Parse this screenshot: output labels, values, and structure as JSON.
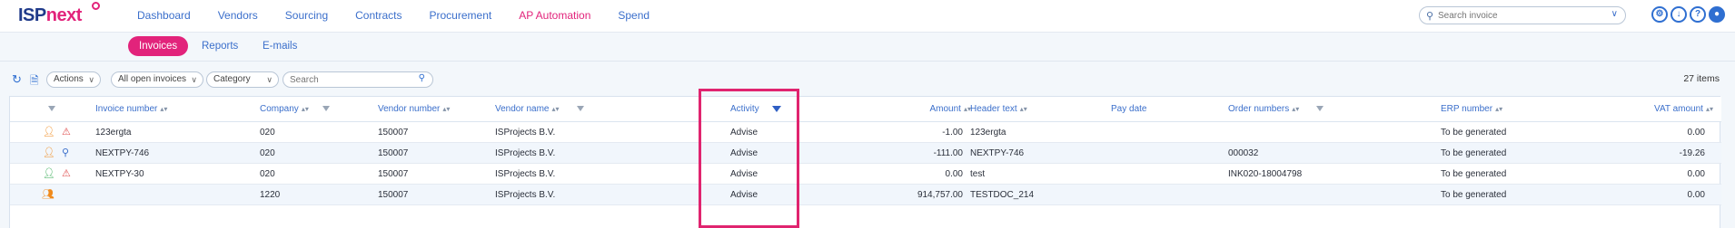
{
  "brand": {
    "part1": "ISP",
    "part2": "next"
  },
  "nav": [
    {
      "label": "Dashboard",
      "active": false
    },
    {
      "label": "Vendors",
      "active": false
    },
    {
      "label": "Sourcing",
      "active": false
    },
    {
      "label": "Contracts",
      "active": false
    },
    {
      "label": "Procurement",
      "active": false
    },
    {
      "label": "AP Automation",
      "active": true
    },
    {
      "label": "Spend",
      "active": false
    }
  ],
  "top_search": {
    "placeholder": "Search invoice"
  },
  "tool_icons": [
    "settings-icon",
    "download-icon",
    "help-icon",
    "user-icon"
  ],
  "subnav": {
    "invoices": "Invoices",
    "reports": "Reports",
    "emails": "E-mails"
  },
  "toolbar": {
    "actions": "Actions",
    "view": "All open invoices",
    "category": "Category",
    "search_placeholder": "Search",
    "count": "27 items"
  },
  "columns": {
    "invoice_number": "Invoice number",
    "company": "Company",
    "vendor_number": "Vendor number",
    "vendor_name": "Vendor name",
    "activity": "Activity",
    "amount": "Amount",
    "header_text": "Header text",
    "pay_date": "Pay date",
    "order_numbers": "Order numbers",
    "erp_number": "ERP number",
    "vat_amount": "VAT amount"
  },
  "rows": [
    {
      "status_icon": "user-outline-icon",
      "alert_icon": "warning-icon",
      "invoice_number": "123ergta",
      "company": "020",
      "vendor_number": "150007",
      "vendor_name": "ISProjects B.V.",
      "activity": "Advise",
      "amount": "-1.00",
      "header_text": "123ergta",
      "pay_date": "",
      "order_numbers": "",
      "erp_number": "To be generated",
      "vat_amount": "0.00"
    },
    {
      "status_icon": "user-outline-icon",
      "alert_icon": "search-doc-icon",
      "invoice_number": "NEXTPY-746",
      "company": "020",
      "vendor_number": "150007",
      "vendor_name": "ISProjects B.V.",
      "activity": "Advise",
      "amount": "-111.00",
      "header_text": "NEXTPY-746",
      "pay_date": "",
      "order_numbers": "000032",
      "erp_number": "To be generated",
      "vat_amount": "-19.26"
    },
    {
      "status_icon": "user-filled-icon",
      "alert_icon": "warning-icon",
      "invoice_number": "NEXTPY-30",
      "company": "020",
      "vendor_number": "150007",
      "vendor_name": "ISProjects B.V.",
      "activity": "Advise",
      "amount": "0.00",
      "header_text": "test",
      "pay_date": "",
      "order_numbers": "INK020-18004798",
      "erp_number": "To be generated",
      "vat_amount": "0.00"
    },
    {
      "status_icon": "users-outline-icon",
      "alert_icon": "",
      "invoice_number": "",
      "company": "1220",
      "vendor_number": "150007",
      "vendor_name": "ISProjects B.V.",
      "activity": "Advise",
      "amount": "914,757.00",
      "header_text": "TESTDOC_214",
      "pay_date": "",
      "order_numbers": "",
      "erp_number": "To be generated",
      "vat_amount": "0.00"
    }
  ],
  "colors": {
    "brand_pink": "#e2237b",
    "brand_blue": "#1f3a8a",
    "link_blue": "#3b6fcb",
    "highlight": "#e0246f"
  }
}
